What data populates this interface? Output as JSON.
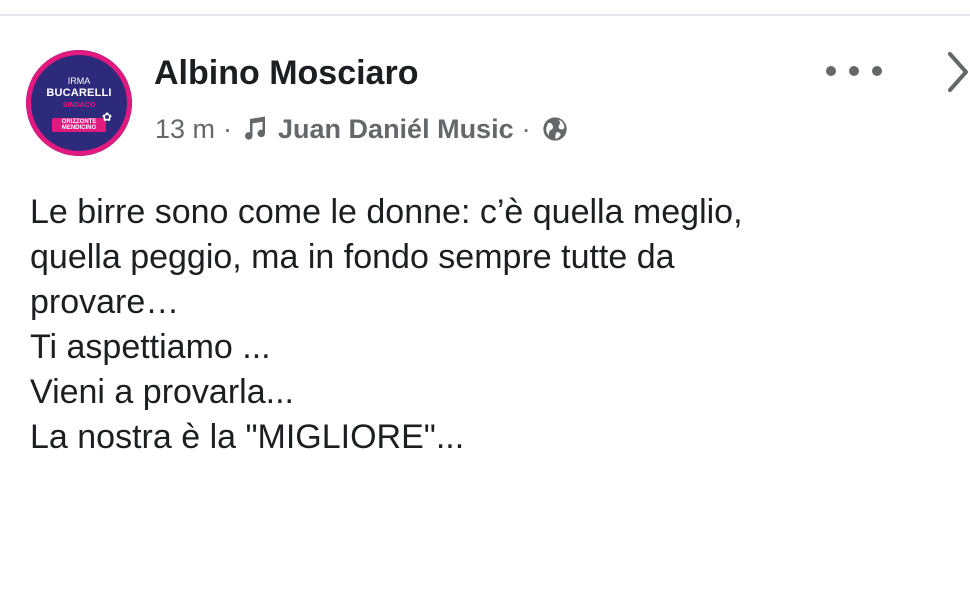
{
  "post": {
    "author": "Albino Mosciaro",
    "time": "13 m",
    "separator": "·",
    "music": "Juan Daniél Music",
    "privacy_icon": "globe-icon",
    "music_icon": "music-note-icon",
    "more_icon": "more-options-icon",
    "close_icon": "chevron-right-icon",
    "avatar": {
      "first_name": "IRMA",
      "last_name": "BUCARELLI",
      "role": "SINDACO",
      "list_name": "ORIZZONTE MENDICINO"
    },
    "body_lines": [
      "Le birre sono come le donne: c’è quella meglio,",
      "quella peggio, ma in fondo sempre tutte da",
      "provare…",
      "Ti aspettiamo ...",
      "Vieni a provarla...",
      "La nostra è la \"MIGLIORE\"..."
    ]
  },
  "colors": {
    "text": "#1c1e21",
    "secondary": "#65676b",
    "avatar_navy": "#2d2a7c",
    "avatar_magenta": "#e2197e"
  }
}
